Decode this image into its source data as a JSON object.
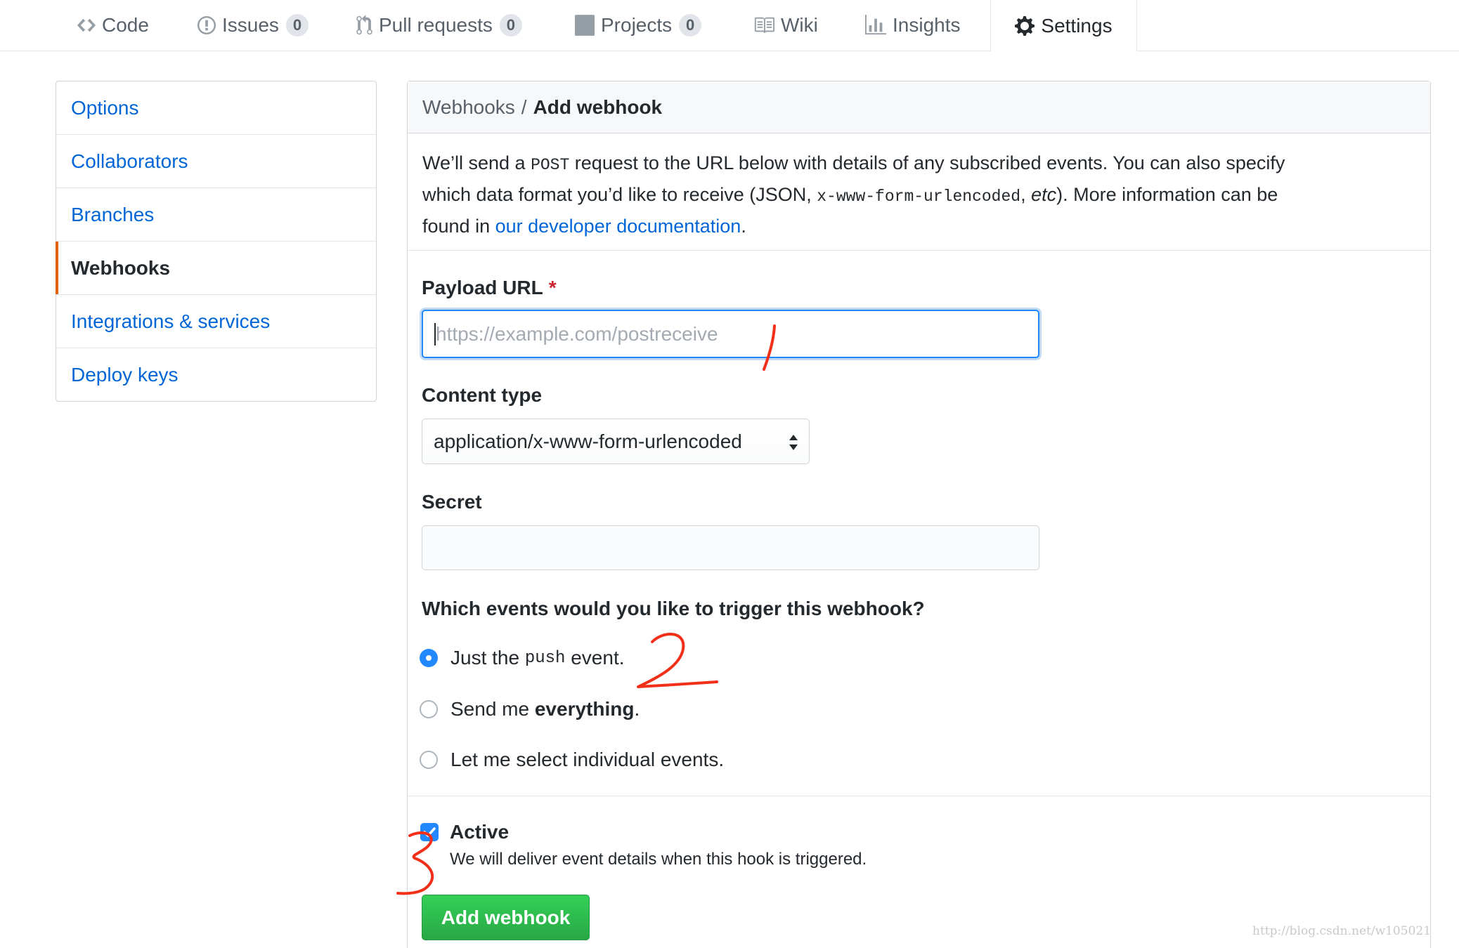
{
  "nav": {
    "code": {
      "label": "Code"
    },
    "issues": {
      "label": "Issues",
      "count": "0"
    },
    "pulls": {
      "label": "Pull requests",
      "count": "0"
    },
    "projects": {
      "label": "Projects",
      "count": "0"
    },
    "wiki": {
      "label": "Wiki"
    },
    "insights": {
      "label": "Insights"
    },
    "settings": {
      "label": "Settings",
      "selected": true
    }
  },
  "sidebar": {
    "items": [
      {
        "label": "Options"
      },
      {
        "label": "Collaborators"
      },
      {
        "label": "Branches"
      },
      {
        "label": "Webhooks",
        "selected": true
      },
      {
        "label": "Integrations & services"
      },
      {
        "label": "Deploy keys"
      }
    ]
  },
  "breadcrumb": {
    "parent": "Webhooks",
    "separator": "/",
    "current": "Add webhook"
  },
  "description": {
    "line1_a": "We’ll send a ",
    "line1_code": "POST",
    "line1_b": " request to the URL below with details of any subscribed events. You can also specify",
    "line2_a": "which data format you’d like to receive (JSON, ",
    "line2_code": "x-www-form-urlencoded",
    "line2_b": ", ",
    "line2_em": "etc",
    "line2_c": "). More information can be",
    "line3_a": "found in ",
    "line3_link": "our developer documentation",
    "line3_b": "."
  },
  "form": {
    "payload_label": "Payload URL",
    "required_marker": "*",
    "payload_placeholder": "https://example.com/postreceive",
    "payload_value": "",
    "content_type_label": "Content type",
    "content_type_value": "application/x-www-form-urlencoded",
    "secret_label": "Secret",
    "secret_value": "",
    "events_question": "Which events would you like to trigger this webhook?",
    "event_options": [
      {
        "a": "Just the ",
        "code": "push",
        "b": " event.",
        "checked": true
      },
      {
        "a": "Send me ",
        "strong": "everything",
        "b": ".",
        "checked": false
      },
      {
        "a": "Let me select individual events.",
        "checked": false
      }
    ],
    "active_label": "Active",
    "active_checked": true,
    "active_note": "We will deliver event details when this hook is triggered.",
    "submit_label": "Add webhook"
  },
  "annotations": {
    "marks": [
      "1",
      "2",
      "3"
    ]
  },
  "watermark": "http://blog.csdn.net/w105021",
  "colors": {
    "link": "#0366d6",
    "selected_accent": "#e36209",
    "focus": "#2188ff",
    "button_green": "#28a745",
    "annotation_red": "#f2301a"
  }
}
